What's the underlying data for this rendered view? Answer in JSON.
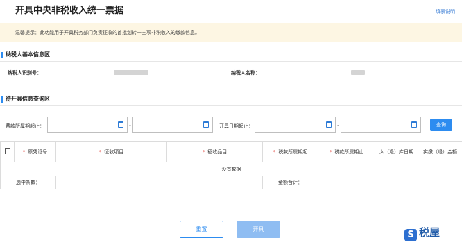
{
  "page": {
    "title": "开具中央非税收入统一票据",
    "help_link": "填表说明"
  },
  "notice": {
    "text": "温馨提示：此功能用于开具税务部门负责征收的首批划转十三项非税收入的缴款信息。"
  },
  "taxpayer_section": {
    "heading": "纳税人基本信息区",
    "id_label": "纳税人识别号：",
    "name_label": "纳税人名称："
  },
  "query_section": {
    "heading": "待开具信息查询区",
    "period_label": "费款所属期起止：",
    "issue_date_label": "开具日期起止：",
    "separator": "-",
    "query_button": "查询"
  },
  "table": {
    "columns": [
      "原凭证号",
      "征收项目",
      "征收品目",
      "税款所属期起",
      "税款所属期止",
      "入（退）库日期",
      "实缴（退）金额"
    ],
    "required_marker": "*",
    "empty_text": "没有数据",
    "selected_count_label": "选中条数：",
    "total_amount_label": "金额合计："
  },
  "actions": {
    "reset": "重置",
    "issue": "开具"
  },
  "brand": {
    "logo_text": "税屋",
    "logo_glyph": "S"
  },
  "colors": {
    "accent": "#2d8cf0",
    "notice_bg": "#fdf6e3",
    "required": "#e0342c"
  }
}
